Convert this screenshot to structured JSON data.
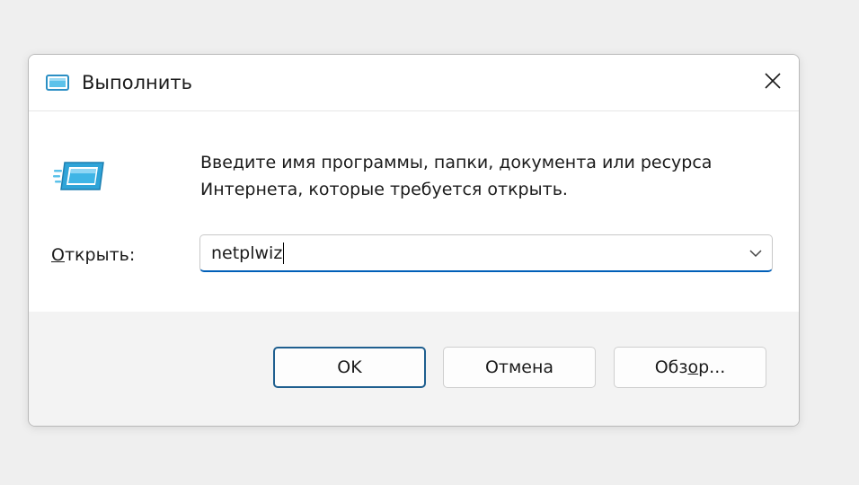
{
  "window": {
    "title": "Выполнить",
    "close_label": "Close"
  },
  "body": {
    "description_line1": "Введите имя программы, папки, документа или ресурса",
    "description_line2": "Интернета, которые требуется открыть.",
    "open_label_first": "О",
    "open_label_rest": "ткрыть:",
    "input_value": "netplwiz"
  },
  "buttons": {
    "ok": "OK",
    "cancel": "Отмена",
    "browse_pre": "Обз",
    "browse_u": "о",
    "browse_post": "р..."
  },
  "colors": {
    "accent": "#005fb8",
    "icon_blue": "#2fa4d8"
  },
  "icons": {
    "title_icon": "run-icon",
    "big_icon": "run-icon",
    "close_icon": "close-icon",
    "chevron": "chevron-down-icon"
  }
}
